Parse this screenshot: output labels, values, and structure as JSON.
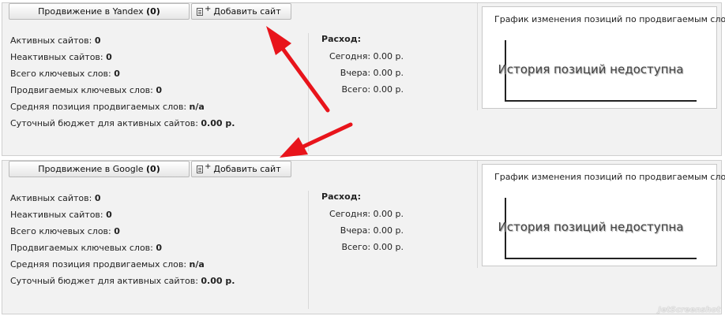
{
  "yandex": {
    "promote_label": "Продвижение в Yandex",
    "promote_count": "(0)",
    "add_label": "Добавить сайт",
    "stats": [
      {
        "label": "Активных сайтов:",
        "value": "0"
      },
      {
        "label": "Неактивных сайтов:",
        "value": "0"
      },
      {
        "label": "Всего ключевых слов:",
        "value": "0"
      },
      {
        "label": "Продвигаемых ключевых слов:",
        "value": "0"
      },
      {
        "label": "Средняя позиция продвигаемых слов:",
        "value": "n/a"
      },
      {
        "label": "Суточный бюджет для активных сайтов:",
        "value": "0.00 р."
      }
    ],
    "expenses": {
      "title": "Расход:",
      "rows": [
        "Сегодня: 0.00 р.",
        "Вчера: 0.00 р.",
        "Всего: 0.00 р."
      ]
    },
    "chart": {
      "title": "График изменения позиций по продвигаемым словам",
      "message": "История позиций недоступна"
    }
  },
  "google": {
    "promote_label": "Продвижение в Google",
    "promote_count": "(0)",
    "add_label": "Добавить сайт",
    "stats": [
      {
        "label": "Активных сайтов:",
        "value": "0"
      },
      {
        "label": "Неактивных сайтов:",
        "value": "0"
      },
      {
        "label": "Всего ключевых слов:",
        "value": "0"
      },
      {
        "label": "Продвигаемых ключевых слов:",
        "value": "0"
      },
      {
        "label": "Средняя позиция продвигаемых слов:",
        "value": "n/a"
      },
      {
        "label": "Суточный бюджет для активных сайтов:",
        "value": "0.00 р."
      }
    ],
    "expenses": {
      "title": "Расход:",
      "rows": [
        "Сегодня: 0.00 р.",
        "Вчера: 0.00 р.",
        "Всего: 0.00 р."
      ]
    },
    "chart": {
      "title": "График изменения позиций по продвигаемым словам",
      "message": "История позиций недоступна"
    }
  },
  "colors": {
    "arrow": "#e8141b",
    "panel_bg": "#f2f2f2"
  },
  "icons": {
    "add_site": "document-plus-icon"
  },
  "watermark": "JetScreenshot"
}
